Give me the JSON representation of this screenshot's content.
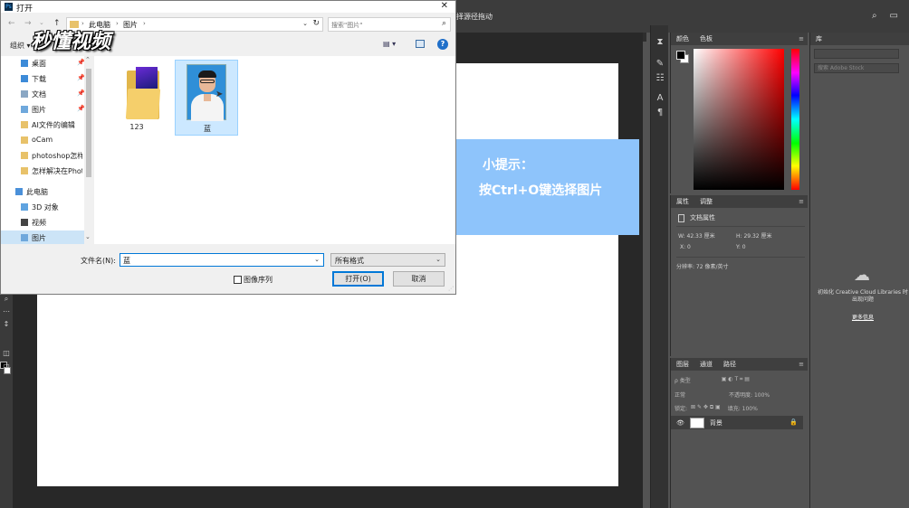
{
  "photoshop": {
    "options_text": "择源径拖动",
    "color_panel": {
      "tabs": [
        "颜色",
        "色板"
      ]
    },
    "properties_panel": {
      "tabs": [
        "属性",
        "调整"
      ],
      "doc_label": "文档属性",
      "width": "W: 42.33 厘米",
      "height": "H: 29.32 厘米",
      "x": "X: 0",
      "y": "Y: 0",
      "resolution": "分辨率: 72 像素/英寸"
    },
    "layers_panel": {
      "tabs": [
        "图层",
        "通道",
        "路径"
      ],
      "kind_label": "ρ 类型",
      "blend_mode": "正常",
      "opacity_label": "不透明度: 100%",
      "lock_label": "锁定:",
      "fill_label": "填充: 100%",
      "layer_name": "背景"
    },
    "libraries_panel": {
      "tab": "库",
      "search_placeholder": "搜索 Adobe Stock",
      "message": "初始化 Creative Cloud Libraries 时出现问题",
      "more_link": "更多信息"
    }
  },
  "tip": {
    "title": "小提示：",
    "body": "按Ctrl+O键选择图片"
  },
  "watermark": "秒懂视频",
  "dialog": {
    "title": "打开",
    "close_glyph": "✕",
    "breadcrumbs": [
      "此电脑",
      "图片"
    ],
    "search_placeholder": "搜索\"图片\"",
    "organize_label": "组织 ▾",
    "help_glyph": "?",
    "nav_items": [
      {
        "label": "桌面",
        "pinned": true
      },
      {
        "label": "下载",
        "pinned": true
      },
      {
        "label": "文档",
        "pinned": true
      },
      {
        "label": "图片",
        "pinned": true
      },
      {
        "label": "AI文件的编辑",
        "pinned": false
      },
      {
        "label": "oCam",
        "pinned": false
      },
      {
        "label": "photoshop怎样",
        "pinned": false
      },
      {
        "label": "怎样解决在Phot",
        "pinned": false
      },
      {
        "label": "此电脑",
        "pinned": false
      },
      {
        "label": "3D 对象",
        "pinned": false
      },
      {
        "label": "视频",
        "pinned": false
      },
      {
        "label": "图片",
        "pinned": false
      }
    ],
    "files": [
      {
        "name": "123",
        "kind": "folder"
      },
      {
        "name": "蓝",
        "kind": "image"
      }
    ],
    "filename_label": "文件名(N):",
    "filename_value": "蓝",
    "filetype_value": "所有格式",
    "sequence_label": "图像序列",
    "open_label": "打开(O)",
    "cancel_label": "取消"
  }
}
